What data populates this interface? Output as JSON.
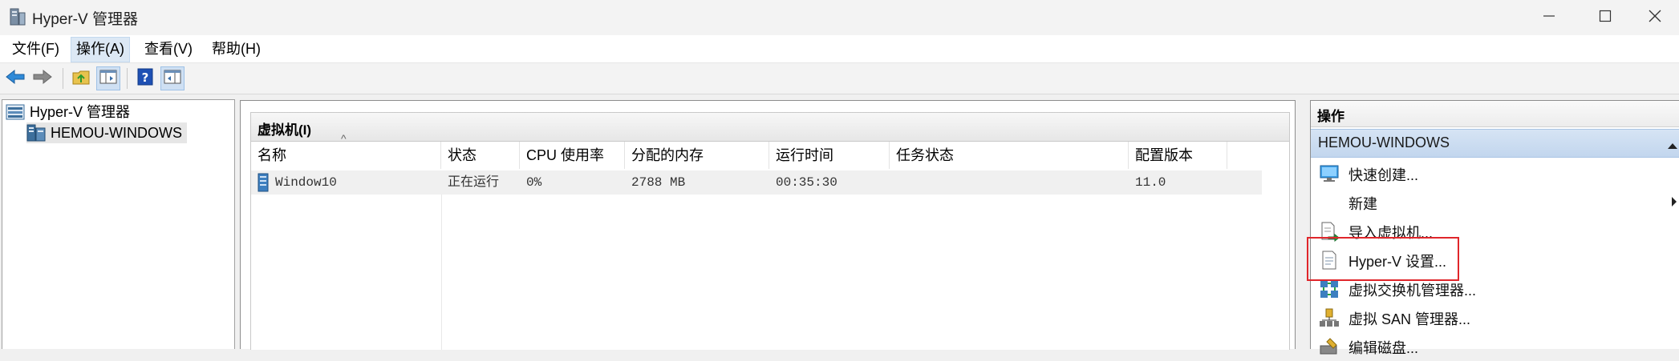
{
  "window": {
    "title": "Hyper-V 管理器",
    "icon": "hyperv-manager-icon",
    "controls": [
      "minimize-icon",
      "maximize-icon",
      "close-icon"
    ]
  },
  "menu": {
    "items": [
      {
        "label": "文件(F)",
        "active": false
      },
      {
        "label": "操作(A)",
        "active": true
      },
      {
        "label": "查看(V)",
        "active": false
      },
      {
        "label": "帮助(H)",
        "active": false
      }
    ]
  },
  "toolbar": {
    "buttons": [
      "back-arrow-icon",
      "forward-arrow-icon",
      "up-folder-icon",
      "show-hide-tree-icon",
      "help-icon",
      "show-hide-action-pane-icon"
    ]
  },
  "tree": {
    "root": "Hyper-V 管理器",
    "server": "HEMOU-WINDOWS"
  },
  "vm_panel": {
    "title": "虚拟机(I)",
    "sort_indicator": "^",
    "columns": [
      "名称",
      "状态",
      "CPU 使用率",
      "分配的内存",
      "运行时间",
      "任务状态",
      "配置版本"
    ],
    "rows": [
      {
        "name": "Window10",
        "state": "正在运行",
        "cpu": "0%",
        "memory": "2788 MB",
        "uptime": "00:35:30",
        "task": "",
        "version": "11.0"
      }
    ]
  },
  "actions": {
    "title": "操作",
    "group": "HEMOU-WINDOWS",
    "items": [
      {
        "label": "快速创建...",
        "icon": "quick-create-icon"
      },
      {
        "label": "新建",
        "icon": "",
        "submenu": true
      },
      {
        "label": "导入虚拟机...",
        "icon": "import-vm-icon"
      },
      {
        "label": "Hyper-V 设置...",
        "icon": "hyperv-settings-icon",
        "highlighted": true
      },
      {
        "label": "虚拟交换机管理器...",
        "icon": "virtual-switch-icon"
      },
      {
        "label": "虚拟 SAN 管理器...",
        "icon": "virtual-san-icon"
      },
      {
        "label": "编辑磁盘...",
        "icon": "edit-disk-icon"
      }
    ]
  },
  "colors": {
    "selection_red": "#e0262b",
    "group_header": "#c2d6ee",
    "accent_blue": "#1e6fd9"
  }
}
